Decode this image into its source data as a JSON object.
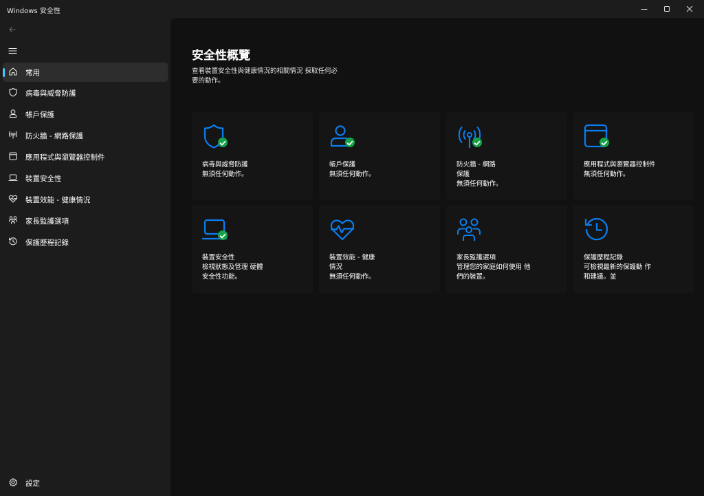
{
  "window": {
    "title": "Windows 安全性"
  },
  "sidebar": {
    "items": [
      {
        "label": "常用",
        "icon": "home-icon",
        "active": true
      },
      {
        "label": "病毒與威脅防護",
        "icon": "shield-icon"
      },
      {
        "label": "帳戶保護",
        "icon": "person-icon"
      },
      {
        "label": "防火牆 - 網路保護",
        "icon": "antenna-icon"
      },
      {
        "label": "應用程式與瀏覽器控制件",
        "icon": "app-window-icon"
      },
      {
        "label": "裝置安全性",
        "icon": "laptop-icon"
      },
      {
        "label": "裝置效能 - 健康情況",
        "icon": "heart-pulse-icon"
      },
      {
        "label": "家長監護選項",
        "icon": "family-icon"
      },
      {
        "label": "保護歷程記錄",
        "icon": "history-icon"
      }
    ],
    "settings_label": "設定"
  },
  "main": {
    "title": "安全性概覽",
    "subtitle": "查看裝置安全性與健康情況的相關情況 採取任何必要的動作。",
    "cards": [
      {
        "title": "病毒與威脅防護",
        "desc": "無須任何動作。",
        "icon": "shield-icon",
        "status": "ok"
      },
      {
        "title": "帳戶保護",
        "desc": "無須任何動作。",
        "icon": "person-icon",
        "status": "ok"
      },
      {
        "title": "防火牆 - 網路保護",
        "desc": "無須任何動作。",
        "icon": "antenna-icon",
        "status": "ok"
      },
      {
        "title": "應用程式與瀏覽器控制件",
        "desc": "無須任何動作。",
        "icon": "app-window-icon",
        "status": "ok"
      },
      {
        "title": "裝置安全性",
        "desc": "檢視狀態及管理 硬體安全性功能。",
        "icon": "laptop-icon",
        "status": "ok"
      },
      {
        "title": "裝置效能 - 健康情況",
        "desc": "無須任何動作。",
        "icon": "heart-pulse-icon",
        "status": "none"
      },
      {
        "title": "家長監護選項",
        "desc": "管理您的家庭如何使用 他們的裝置。",
        "icon": "family-icon",
        "status": "none"
      },
      {
        "title": "保護歷程記錄",
        "desc": "可檢視最新的保護動 作和建議。並",
        "icon": "history-icon",
        "status": "none"
      }
    ]
  },
  "colors": {
    "accent": "#4cc2ff",
    "icon_blue": "#0a7ef0",
    "ok_green": "#16a34a"
  }
}
